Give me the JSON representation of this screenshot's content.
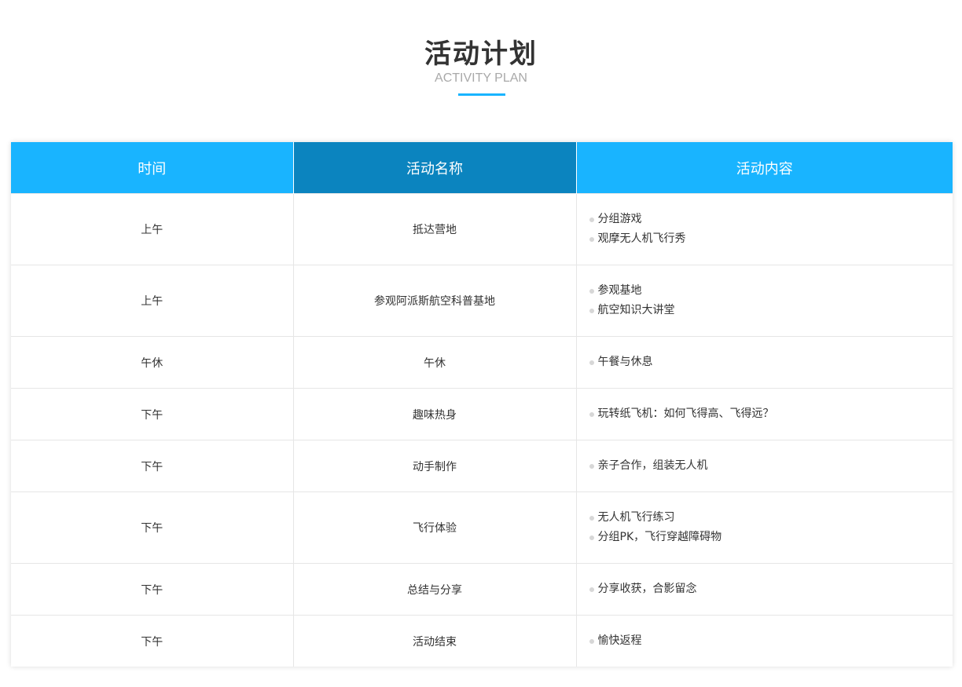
{
  "header": {
    "title": "活动计划",
    "subtitle": "ACTIVITY PLAN"
  },
  "colors": {
    "accent": "#19b4ff",
    "header_active": "#0b84bf",
    "bullet": "#d7d7d7"
  },
  "table": {
    "columns": [
      "时间",
      "活动名称",
      "活动内容"
    ],
    "rows": [
      {
        "time": "上午",
        "name": "抵达营地",
        "content": [
          "分组游戏",
          "观摩无人机飞行秀"
        ]
      },
      {
        "time": "上午",
        "name": "参观阿派斯航空科普基地",
        "content": [
          "参观基地",
          "航空知识大讲堂"
        ]
      },
      {
        "time": "午休",
        "name": "午休",
        "content": [
          "午餐与休息"
        ]
      },
      {
        "time": "下午",
        "name": "趣味热身",
        "content": [
          "玩转纸飞机：如何飞得高、飞得远？"
        ]
      },
      {
        "time": "下午",
        "name": "动手制作",
        "content": [
          "亲子合作，组装无人机"
        ]
      },
      {
        "time": "下午",
        "name": "飞行体验",
        "content": [
          "无人机飞行练习",
          "分组PK，飞行穿越障碍物"
        ]
      },
      {
        "time": "下午",
        "name": "总结与分享",
        "content": [
          "分享收获，合影留念"
        ]
      },
      {
        "time": "下午",
        "name": "活动结束",
        "content": [
          "愉快返程"
        ]
      }
    ]
  }
}
